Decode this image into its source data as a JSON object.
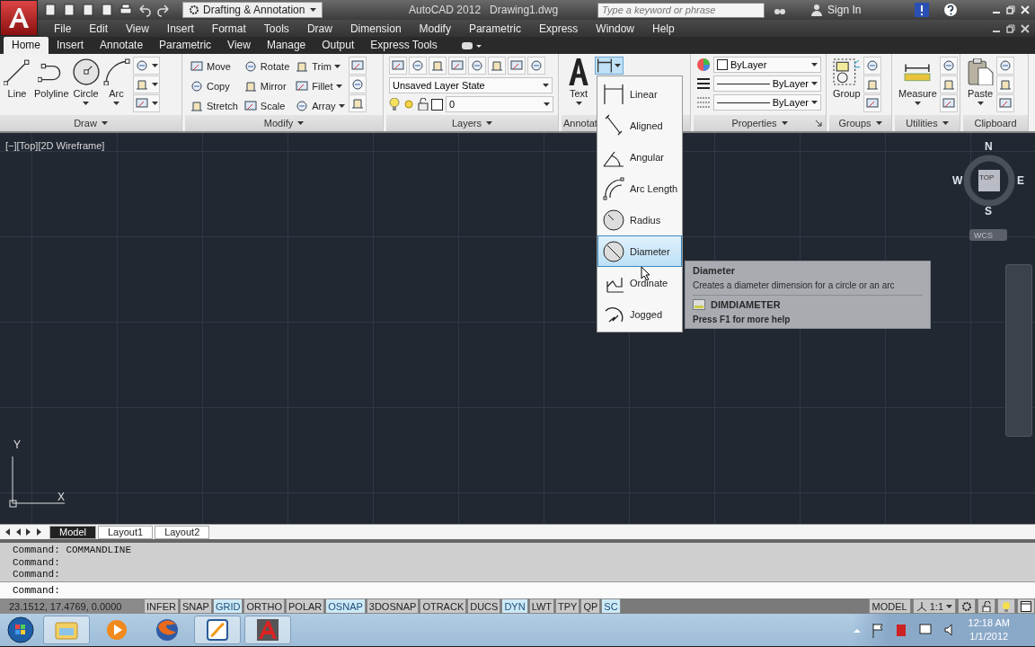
{
  "title_bar": {
    "workspace": "Drafting & Annotation",
    "app_title": "AutoCAD 2012",
    "document": "Drawing1.dwg",
    "search": {
      "placeholder": "Type a keyword or phrase"
    },
    "sign_in": "Sign In"
  },
  "menu_bar": [
    "File",
    "Edit",
    "View",
    "Insert",
    "Format",
    "Tools",
    "Draw",
    "Dimension",
    "Modify",
    "Parametric",
    "Express",
    "Window",
    "Help"
  ],
  "ribbon_tabs": [
    {
      "label": "Home",
      "selected": true
    },
    {
      "label": "Insert",
      "selected": false
    },
    {
      "label": "Annotate",
      "selected": false
    },
    {
      "label": "Parametric",
      "selected": false
    },
    {
      "label": "View",
      "selected": false
    },
    {
      "label": "Manage",
      "selected": false
    },
    {
      "label": "Output",
      "selected": false
    },
    {
      "label": "Express Tools",
      "selected": false
    }
  ],
  "ribbon_panels": [
    {
      "title": "Draw",
      "menu": true,
      "sections": [
        {
          "kind": "line",
          "label": "Line",
          "menu": false
        },
        {
          "kind": "polyline",
          "label": "Polyline",
          "menu": false
        },
        {
          "kind": "circle",
          "label": "Circle",
          "menu": true
        },
        {
          "kind": "arc",
          "label": "Arc",
          "menu": true
        },
        {
          "kind": "stack",
          "items": [
            {
              "menu": true
            },
            {
              "menu": true
            },
            {
              "menu": true
            }
          ]
        }
      ]
    },
    {
      "title": "Modify",
      "menu": true,
      "sections": [
        {
          "kind": "stack",
          "items": [
            {
              "label": "Move",
              "menu": false
            },
            {
              "label": "Copy",
              "menu": false
            },
            {
              "label": "Stretch",
              "menu": false
            }
          ]
        },
        {
          "kind": "stack",
          "items": [
            {
              "label": "Rotate",
              "menu": false
            },
            {
              "label": "Mirror",
              "menu": false
            },
            {
              "label": "Scale",
              "menu": false
            }
          ]
        },
        {
          "kind": "stack",
          "items": [
            {
              "label": "Trim",
              "menu": true
            },
            {
              "label": "Fillet",
              "menu": true
            },
            {
              "label": "Array",
              "menu": true
            }
          ]
        },
        {
          "kind": "stack",
          "items": [
            {
              "menu": false
            },
            {
              "menu": false
            },
            {
              "menu": false
            }
          ]
        }
      ]
    },
    {
      "title": "Layers",
      "menu": true,
      "sections": [
        {
          "kind": "combos",
          "items": [
            {
              "kind": "icon-row"
            },
            {
              "kind": "combo",
              "value": "Unsaved Layer State"
            },
            {
              "kind": "layer",
              "value": "0"
            }
          ]
        }
      ]
    },
    {
      "title": "Annotat",
      "menu": false,
      "sections": [
        {
          "kind": "text",
          "label": "Text",
          "menu": true
        },
        {
          "kind": "dimension",
          "expanded": true
        }
      ]
    },
    {
      "title": "Properties",
      "menu": true,
      "launcher": true,
      "sections": [
        {
          "kind": "combos",
          "items": [
            {
              "kind": "color",
              "value": "ByLayer"
            },
            {
              "kind": "lineweight",
              "value": "ByLayer"
            },
            {
              "kind": "linetype",
              "value": "ByLayer"
            }
          ]
        }
      ]
    },
    {
      "title": "Groups",
      "menu": true,
      "sections": [
        {
          "kind": "group",
          "label": "Group",
          "menu": false
        },
        {
          "kind": "stack",
          "items": [
            {
              "menu": false
            },
            {
              "menu": false
            },
            {
              "menu": false
            }
          ]
        }
      ]
    },
    {
      "title": "Utilities",
      "menu": true,
      "sections": [
        {
          "kind": "measure",
          "label": "Measure",
          "menu": true
        },
        {
          "kind": "stack",
          "items": [
            {
              "menu": false
            },
            {
              "menu": false
            },
            {
              "menu": false
            }
          ]
        }
      ]
    },
    {
      "title": "Clipboard",
      "menu": false,
      "sections": [
        {
          "kind": "paste",
          "label": "Paste",
          "menu": true
        },
        {
          "kind": "stack",
          "items": [
            {
              "menu": false
            },
            {
              "menu": false
            },
            {
              "menu": false
            }
          ]
        }
      ]
    }
  ],
  "viewport": {
    "label": "[−][Top][2D Wireframe]",
    "compass": {
      "north": "N",
      "west": "W",
      "east": "E",
      "south": "S",
      "face": "TOP",
      "ucs": "WCS"
    },
    "axes": {
      "y": "Y",
      "x": "X"
    }
  },
  "dimension_menu": {
    "items": [
      {
        "kind": "linear",
        "label": "Linear",
        "selected": false
      },
      {
        "kind": "aligned",
        "label": "Aligned",
        "selected": false
      },
      {
        "kind": "angular",
        "label": "Angular",
        "selected": false
      },
      {
        "kind": "arc",
        "label": "Arc Length",
        "selected": false
      },
      {
        "kind": "radius",
        "label": "Radius",
        "selected": false
      },
      {
        "kind": "diameter",
        "label": "Diameter",
        "selected": true
      },
      {
        "kind": "ordinate",
        "label": "Ordinate",
        "selected": false
      },
      {
        "kind": "jogged",
        "label": "Jogged",
        "selected": false
      }
    ]
  },
  "tooltip": {
    "title": "Diameter",
    "description": "Creates a diameter dimension for a circle or an arc",
    "command": "DIMDIAMETER",
    "help": "Press F1 for more help"
  },
  "layout_tabs": [
    {
      "label": "Model",
      "selected": true
    },
    {
      "label": "Layout1",
      "selected": false
    },
    {
      "label": "Layout2",
      "selected": false
    }
  ],
  "command_history": [
    "Command: COMMANDLINE",
    "Command:",
    "Command:"
  ],
  "command_prompt": "Command:",
  "status_bar": {
    "coordinates": "23.1512, 17.4769, 0.0000",
    "toggles": [
      {
        "label": "INFER",
        "on": false
      },
      {
        "label": "SNAP",
        "on": false
      },
      {
        "label": "GRID",
        "on": true
      },
      {
        "label": "ORTHO",
        "on": false
      },
      {
        "label": "POLAR",
        "on": false
      },
      {
        "label": "OSNAP",
        "on": true
      },
      {
        "label": "3DOSNAP",
        "on": false
      },
      {
        "label": "OTRACK",
        "on": false
      },
      {
        "label": "DUCS",
        "on": false
      },
      {
        "label": "DYN",
        "on": true
      },
      {
        "label": "LWT",
        "on": false
      },
      {
        "label": "TPY",
        "on": false
      },
      {
        "label": "QP",
        "on": false
      },
      {
        "label": "SC",
        "on": true
      }
    ],
    "space": "MODEL",
    "scale": "1:1"
  },
  "taskbar": {
    "apps": [
      {
        "kind": "folder",
        "selected": true
      },
      {
        "kind": "media",
        "selected": false
      },
      {
        "kind": "browser",
        "selected": false
      },
      {
        "kind": "editor",
        "selected": true
      },
      {
        "kind": "cad",
        "selected": true
      }
    ],
    "time": "12:18 AM",
    "date": "1/1/2012"
  }
}
